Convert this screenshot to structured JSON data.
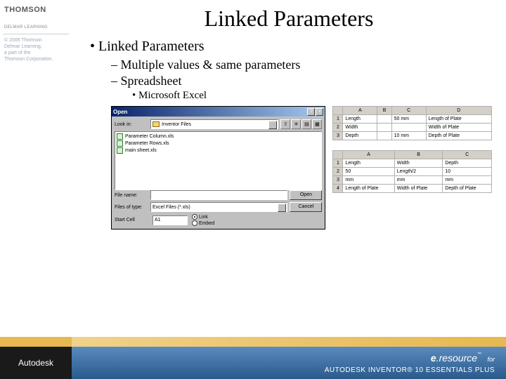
{
  "sidebar": {
    "brand_name": "THOMSON",
    "brand_sub": "DELMAR LEARNING",
    "copyright_lines": [
      "© 2006 Thomson",
      "Delmar Learning,",
      "a part of the",
      "Thomson Corporation."
    ]
  },
  "slide": {
    "title": "Linked Parameters",
    "bullets": {
      "l1": "Linked Parameters",
      "l2a": "Multiple values & same parameters",
      "l2b": "Spreadsheet",
      "l3": "Microsoft Excel"
    }
  },
  "dialog": {
    "title": "Open",
    "lookin_label": "Look in:",
    "lookin_value": "Inventor Files",
    "files": [
      "Parameter Column.xls",
      "Parameter Rows.xls",
      "main sheet.xls"
    ],
    "filename_label": "File name:",
    "filename_value": "",
    "filetype_label": "Files of type:",
    "filetype_value": "Excel Files (*.xls)",
    "open_btn": "Open",
    "cancel_btn": "Cancel",
    "startcell_label": "Start Cell",
    "startcell_value": "A1",
    "radio_link": "Link",
    "radio_embed": "Embed"
  },
  "sheet1": {
    "cols": [
      "A",
      "B",
      "C",
      "D"
    ],
    "rows": [
      {
        "n": "1",
        "a": "Length",
        "b": "",
        "c": "50 mm",
        "d": "Length of Plate"
      },
      {
        "n": "2",
        "a": "Width",
        "b": "",
        "c": "",
        "d": "Width of Plate"
      },
      {
        "n": "3",
        "a": "Depth",
        "b": "",
        "c": "10 mm",
        "d": "Depth of Plate"
      }
    ]
  },
  "sheet2": {
    "cols": [
      "A",
      "B",
      "C"
    ],
    "rows": [
      {
        "n": "1",
        "a": "Length",
        "b": "Width",
        "c": "Depth"
      },
      {
        "n": "2",
        "a": "50",
        "b": "Length/2",
        "c": "10"
      },
      {
        "n": "3",
        "a": "mm",
        "b": "mm",
        "c": "mm"
      },
      {
        "n": "4",
        "a": "Length of Plate",
        "b": "Width of Plate",
        "c": "Depth of Plate"
      }
    ]
  },
  "footer": {
    "autodesk": "Autodesk",
    "eresource": "e.resource",
    "for": "for",
    "product": "AUTODESK INVENTOR® 10 ESSENTIALS PLUS"
  }
}
